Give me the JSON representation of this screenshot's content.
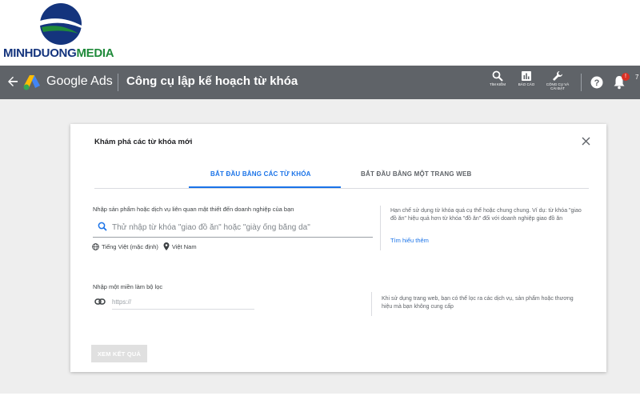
{
  "brand": {
    "name_part1": "MINHDUONG",
    "name_part2": "MEDIA",
    "colors": {
      "primary": "#14347d",
      "secondary": "#1f8a3a"
    }
  },
  "topbar": {
    "app_name": "Google Ads",
    "page_title": "Công cụ lập kế hoạch từ khóa",
    "tools": [
      {
        "icon": "search-icon",
        "label": "TÌM KIẾM"
      },
      {
        "icon": "reports-icon",
        "label": "BÁO CÁO"
      },
      {
        "icon": "wrench-icon",
        "label_line1": "CÔNG CỤ VÀ",
        "label_line2": "CÀI ĐẶT"
      }
    ],
    "overflow_text": "7",
    "colors": {
      "bar": "#5f6368",
      "badge": "#d93025"
    }
  },
  "dialog": {
    "title": "Khám phá các từ khóa mới",
    "tabs": [
      {
        "label": "BẮT ĐẦU BẰNG CÁC TỪ KHÓA",
        "selected": true
      },
      {
        "label": "BẮT ĐẦU BẰNG MỘT TRANG WEB",
        "selected": false
      }
    ],
    "keywords_section": {
      "label": "Nhập sản phẩm hoặc dịch vụ liên quan mật thiết đến doanh nghiệp của bạn",
      "placeholder": "Thử nhập từ khóa \"giao đồ ăn\" hoặc \"giày ống bằng da\"",
      "value": "",
      "language": "Tiếng Việt (mặc định)",
      "location": "Việt Nam",
      "hint": "Hạn chế sử dụng từ khóa quá cụ thể hoặc chung chung. Ví dụ: từ khóa \"giao đồ ăn\" hiệu quả hơn từ khóa \"đồ ăn\" đối với doanh nghiệp giao đồ ăn",
      "learn_more": "Tìm hiểu thêm"
    },
    "filter_section": {
      "label": "Nhập một miền làm bộ lọc",
      "placeholder": "https://",
      "value": "",
      "hint": "Khi sử dụng trang web, bạn có thể lọc ra các dịch vụ, sản phẩm hoặc thương hiệu mà bạn không cung cấp"
    },
    "results_button": "XEM KẾT QUẢ",
    "accent_color": "#1a73e8"
  }
}
